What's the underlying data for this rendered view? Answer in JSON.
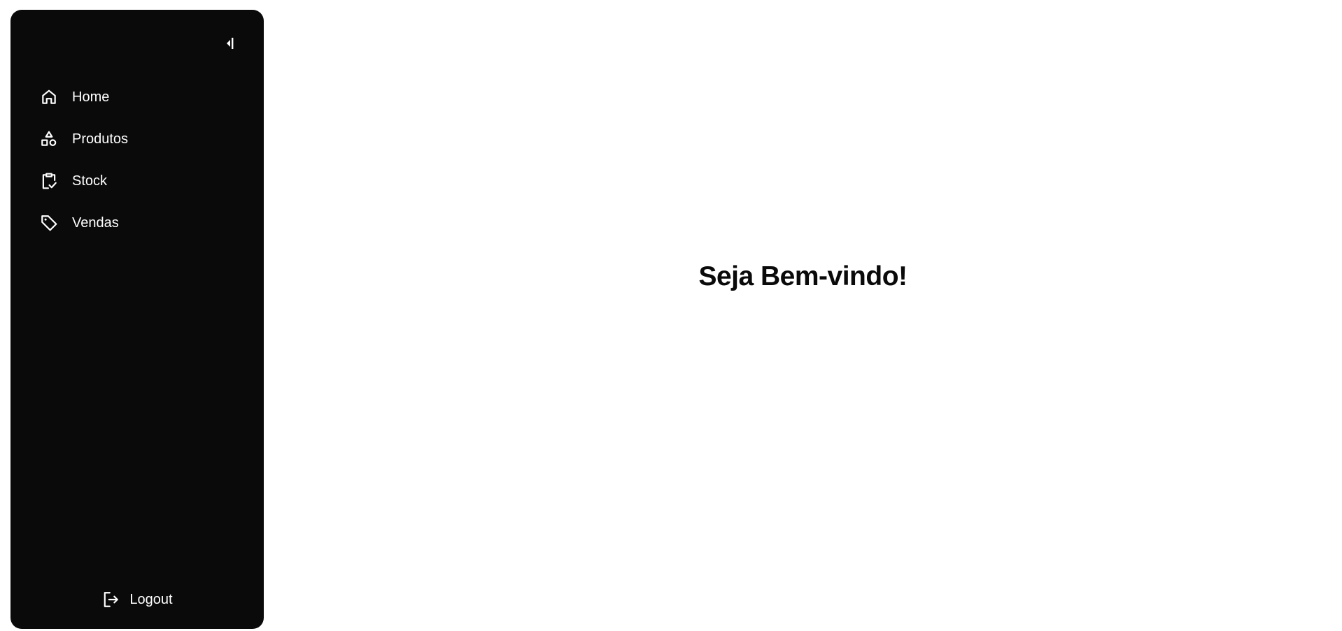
{
  "colors": {
    "sidebar_bg": "#0a0a0a",
    "sidebar_text": "#ffffff",
    "main_bg": "#ffffff",
    "heading": "#0a0a0a"
  },
  "sidebar": {
    "collapse_icon": "collapse-left-icon",
    "items": [
      {
        "label": "Home",
        "icon": "home-icon"
      },
      {
        "label": "Produtos",
        "icon": "shapes-icon"
      },
      {
        "label": "Stock",
        "icon": "clipboard-check-icon"
      },
      {
        "label": "Vendas",
        "icon": "tag-icon"
      }
    ],
    "logout": {
      "label": "Logout",
      "icon": "logout-icon"
    }
  },
  "main": {
    "heading": "Seja Bem-vindo!"
  }
}
